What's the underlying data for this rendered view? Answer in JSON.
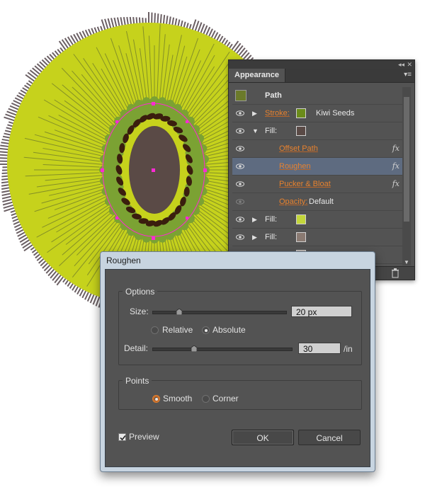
{
  "appearance_panel": {
    "tab_title": "Appearance",
    "rows": [
      {
        "kind": "object",
        "label": "Path"
      },
      {
        "kind": "attr",
        "label": "Stroke:",
        "label_style": "orange",
        "swatch": "#6b8c1a",
        "value": "Kiwi Seeds",
        "expanded": false
      },
      {
        "kind": "attr",
        "label": "Fill:",
        "label_style": "white",
        "swatch": "#5a4a46",
        "value": "",
        "expanded": true
      },
      {
        "kind": "effect",
        "label": "Offset Path",
        "fx": "fx"
      },
      {
        "kind": "effect",
        "label": "Roughen",
        "fx": "fx",
        "selected": true
      },
      {
        "kind": "effect",
        "label": "Pucker & Bloat",
        "fx": "fx"
      },
      {
        "kind": "opacity",
        "label": "Opacity:",
        "value": "Default"
      },
      {
        "kind": "attr",
        "label": "Fill:",
        "label_style": "white",
        "swatch": "#c3d63a",
        "value": "",
        "expanded": false
      },
      {
        "kind": "attr",
        "label": "Fill:",
        "label_style": "white",
        "swatch": "#8a7a72",
        "value": "",
        "expanded": false
      },
      {
        "kind": "attr",
        "label": "Fill:",
        "label_style": "white",
        "swatch": "#a89a92",
        "value": "",
        "expanded": false
      }
    ]
  },
  "dialog": {
    "title": "Roughen",
    "options_title": "Options",
    "size_label": "Size:",
    "size_value": "20 px",
    "size_slider_fraction": 0.2,
    "relative_label": "Relative",
    "absolute_label": "Absolute",
    "detail_label": "Detail:",
    "detail_value": "30",
    "detail_slider_fraction": 0.3,
    "detail_unit": "/in",
    "points_title": "Points",
    "smooth_label": "Smooth",
    "corner_label": "Corner",
    "preview_label": "Preview",
    "ok_label": "OK",
    "cancel_label": "Cancel"
  },
  "colors": {
    "kiwi_flesh": "#c6d21c",
    "kiwi_skin": "#6b5f63",
    "kiwi_inner": "#7ba233",
    "kiwi_core": "#5a4a46",
    "seed": "#3a1e0e",
    "selection_magenta": "#ff2ad4",
    "accent_orange": "#e8822e"
  },
  "icons": {
    "eye": "eye-icon",
    "triangle_right": "triangle-right-icon",
    "triangle_down": "triangle-down-icon",
    "fx": "fx-icon",
    "trash": "trash-icon",
    "panel_menu": "panel-menu-icon",
    "collapse": "collapse-icon"
  }
}
